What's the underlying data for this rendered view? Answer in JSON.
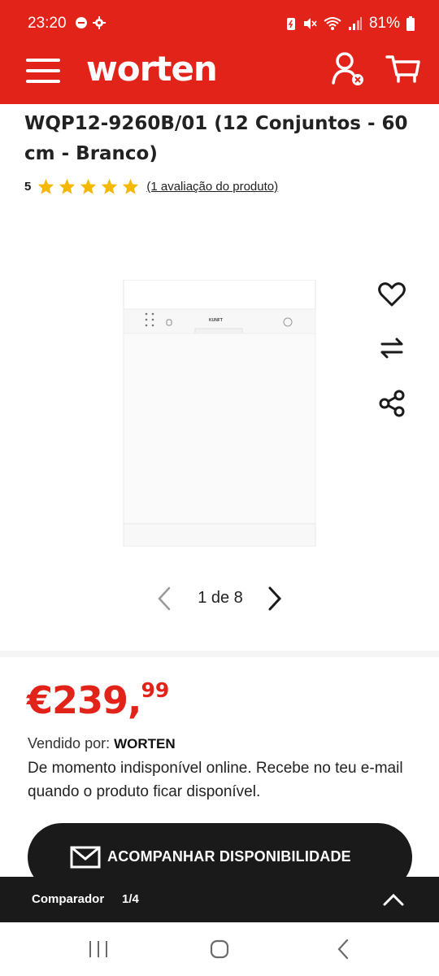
{
  "status_bar": {
    "time": "23:20",
    "battery": "81%",
    "icons": [
      "do-not-disturb-icon",
      "settings-icon",
      "battery-saver-icon",
      "mute-icon",
      "wifi-icon",
      "signal-icon",
      "battery-icon"
    ]
  },
  "header": {
    "logo": "worten",
    "menu_icon": "hamburger-icon",
    "user_icon": "user-icon",
    "cart_icon": "cart-icon"
  },
  "product": {
    "title": "WQP12-9260B/01 (12 Conjuntos - 60 cm - Branco)",
    "rating_score": "5",
    "rating": 5,
    "rating_max": 5,
    "reviews_link": "(1 avaliação do produto)",
    "image_brand": "KUNFT"
  },
  "side_actions": [
    "heart-icon",
    "compare-arrows-icon",
    "share-icon"
  ],
  "gallery": {
    "counter": "1 de 8"
  },
  "pricing": {
    "price_main": "€239,",
    "price_cents": "99",
    "seller_label": "Vendido por: ",
    "seller_name": "WORTEN",
    "availability": "De momento indisponível online. Recebe no teu e-mail quando o produto ficar disponível."
  },
  "follow_button": {
    "label": "ACOMPANHAR DISPONIBILIDADE",
    "icon": "mail-icon"
  },
  "comparator": {
    "label": "Comparador",
    "count": "1/4"
  },
  "colors": {
    "brand_red": "#e2231a",
    "star_yellow": "#f5b800",
    "dark": "#1a1a1a"
  }
}
